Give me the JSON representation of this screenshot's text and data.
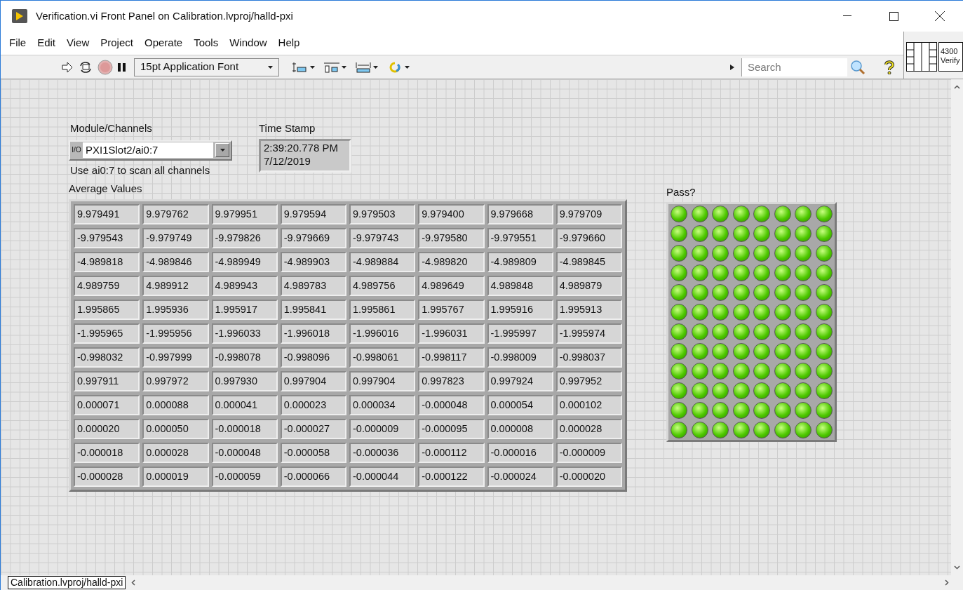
{
  "window": {
    "title": "Verification.vi Front Panel on Calibration.lvproj/halld-pxi"
  },
  "menu": [
    "File",
    "Edit",
    "View",
    "Project",
    "Operate",
    "Tools",
    "Window",
    "Help"
  ],
  "toolbar": {
    "font": "15pt Application Font",
    "search": {
      "placeholder": "Search"
    }
  },
  "vi_icon": {
    "lines": [
      "4300",
      "Verify"
    ]
  },
  "module_channels": {
    "label": "Module/Channels",
    "tag": "I/O",
    "value": "PXI1Slot2/ai0:7",
    "hint": "Use ai0:7 to scan all channels"
  },
  "time_stamp": {
    "label": "Time Stamp",
    "lines": [
      "2:39:20.778 PM",
      "7/12/2019"
    ]
  },
  "average_values": {
    "label": "Average Values",
    "rows": [
      [
        "9.979491",
        "9.979762",
        "9.979951",
        "9.979594",
        "9.979503",
        "9.979400",
        "9.979668",
        "9.979709"
      ],
      [
        "-9.979543",
        "-9.979749",
        "-9.979826",
        "-9.979669",
        "-9.979743",
        "-9.979580",
        "-9.979551",
        "-9.979660"
      ],
      [
        "-4.989818",
        "-4.989846",
        "-4.989949",
        "-4.989903",
        "-4.989884",
        "-4.989820",
        "-4.989809",
        "-4.989845"
      ],
      [
        "4.989759",
        "4.989912",
        "4.989943",
        "4.989783",
        "4.989756",
        "4.989649",
        "4.989848",
        "4.989879"
      ],
      [
        "1.995865",
        "1.995936",
        "1.995917",
        "1.995841",
        "1.995861",
        "1.995767",
        "1.995916",
        "1.995913"
      ],
      [
        "-1.995965",
        "-1.995956",
        "-1.996033",
        "-1.996018",
        "-1.996016",
        "-1.996031",
        "-1.995997",
        "-1.995974"
      ],
      [
        "-0.998032",
        "-0.997999",
        "-0.998078",
        "-0.998096",
        "-0.998061",
        "-0.998117",
        "-0.998009",
        "-0.998037"
      ],
      [
        "0.997911",
        "0.997972",
        "0.997930",
        "0.997904",
        "0.997904",
        "0.997823",
        "0.997924",
        "0.997952"
      ],
      [
        "0.000071",
        "0.000088",
        "0.000041",
        "0.000023",
        "0.000034",
        "-0.000048",
        "0.000054",
        "0.000102"
      ],
      [
        "0.000020",
        "0.000050",
        "-0.000018",
        "-0.000027",
        "-0.000009",
        "-0.000095",
        "0.000008",
        "0.000028"
      ],
      [
        "-0.000018",
        "0.000028",
        "-0.000048",
        "-0.000058",
        "-0.000036",
        "-0.000112",
        "-0.000016",
        "-0.000009"
      ],
      [
        "-0.000028",
        "0.000019",
        "-0.000059",
        "-0.000066",
        "-0.000044",
        "-0.000122",
        "-0.000024",
        "-0.000020"
      ]
    ]
  },
  "pass": {
    "label": "Pass?",
    "leds": [
      [
        {
          "on": true
        },
        {
          "on": true
        },
        {
          "on": true
        },
        {
          "on": true
        },
        {
          "on": true
        },
        {
          "on": true
        },
        {
          "on": true
        },
        {
          "on": true
        }
      ],
      [
        {
          "on": true
        },
        {
          "on": true
        },
        {
          "on": true
        },
        {
          "on": true
        },
        {
          "on": true
        },
        {
          "on": true
        },
        {
          "on": true
        },
        {
          "on": true
        }
      ],
      [
        {
          "on": true
        },
        {
          "on": true
        },
        {
          "on": true
        },
        {
          "on": true
        },
        {
          "on": true
        },
        {
          "on": true
        },
        {
          "on": true
        },
        {
          "on": true
        }
      ],
      [
        {
          "on": true
        },
        {
          "on": true
        },
        {
          "on": true
        },
        {
          "on": true
        },
        {
          "on": true
        },
        {
          "on": true
        },
        {
          "on": true
        },
        {
          "on": true
        }
      ],
      [
        {
          "on": true
        },
        {
          "on": true
        },
        {
          "on": true
        },
        {
          "on": true
        },
        {
          "on": true
        },
        {
          "on": true
        },
        {
          "on": true
        },
        {
          "on": true
        }
      ],
      [
        {
          "on": true
        },
        {
          "on": true
        },
        {
          "on": true
        },
        {
          "on": true
        },
        {
          "on": true
        },
        {
          "on": true
        },
        {
          "on": true
        },
        {
          "on": true
        }
      ],
      [
        {
          "on": true
        },
        {
          "on": true
        },
        {
          "on": true
        },
        {
          "on": true
        },
        {
          "on": true
        },
        {
          "on": true
        },
        {
          "on": true
        },
        {
          "on": true
        }
      ],
      [
        {
          "on": true
        },
        {
          "on": true
        },
        {
          "on": true
        },
        {
          "on": true
        },
        {
          "on": true
        },
        {
          "on": true
        },
        {
          "on": true
        },
        {
          "on": true
        }
      ],
      [
        {
          "on": true
        },
        {
          "on": true
        },
        {
          "on": true
        },
        {
          "on": true
        },
        {
          "on": true
        },
        {
          "on": true
        },
        {
          "on": true
        },
        {
          "on": true
        }
      ],
      [
        {
          "on": true
        },
        {
          "on": true
        },
        {
          "on": true
        },
        {
          "on": true
        },
        {
          "on": true
        },
        {
          "on": true
        },
        {
          "on": true
        },
        {
          "on": true
        }
      ],
      [
        {
          "on": true
        },
        {
          "on": true
        },
        {
          "on": true
        },
        {
          "on": true
        },
        {
          "on": true
        },
        {
          "on": true
        },
        {
          "on": true
        },
        {
          "on": true
        }
      ],
      [
        {
          "on": true
        },
        {
          "on": true
        },
        {
          "on": true
        },
        {
          "on": true
        },
        {
          "on": true
        },
        {
          "on": true
        },
        {
          "on": true
        },
        {
          "on": true
        }
      ]
    ]
  },
  "status_bar": {
    "tab": "Calibration.lvproj/halld-pxi"
  }
}
